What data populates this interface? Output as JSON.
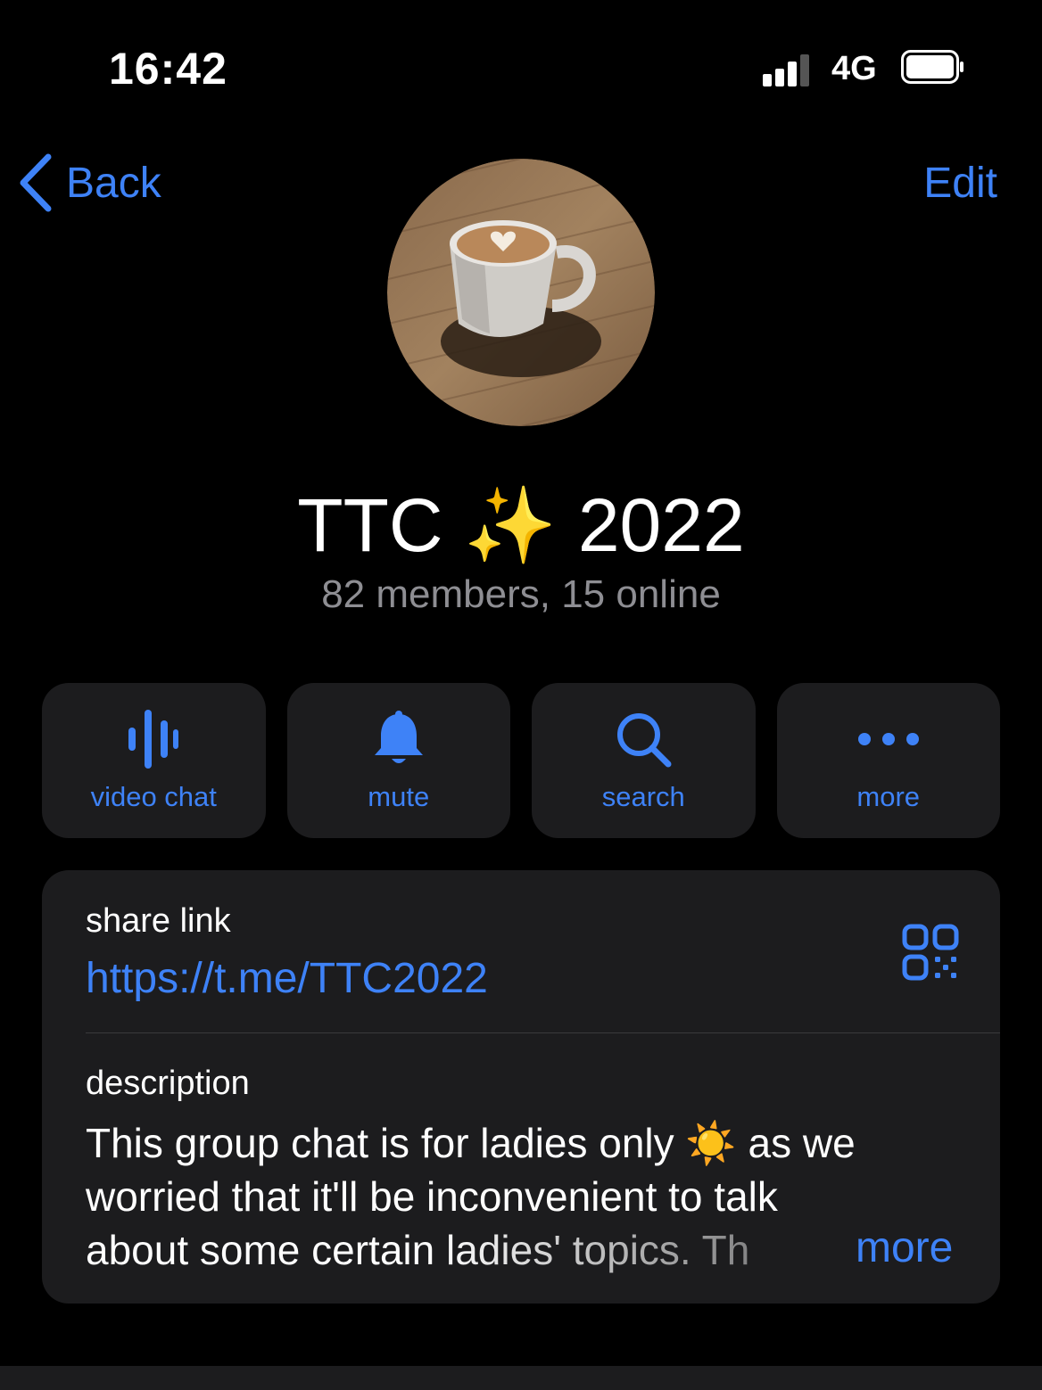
{
  "status_bar": {
    "time": "16:42",
    "network": "4G"
  },
  "nav": {
    "back_label": "Back",
    "edit_label": "Edit"
  },
  "group": {
    "name": "TTC ✨ 2022",
    "members": "82 members, 15 online"
  },
  "actions": [
    {
      "label": "video chat",
      "icon": "video-chat-icon"
    },
    {
      "label": "mute",
      "icon": "bell-icon"
    },
    {
      "label": "search",
      "icon": "search-icon"
    },
    {
      "label": "more",
      "icon": "ellipsis-icon"
    }
  ],
  "info": {
    "share_label": "share link",
    "share_url": "https://t.me/TTC2022",
    "description_label": "description",
    "description_lines": [
      "This group chat is for ladies only ☀️ as we",
      "worried that it'll be inconvenient to talk",
      "about some certain ladies' topics. Th"
    ],
    "more_label": "more"
  },
  "colors": {
    "accent": "#3e82f7",
    "background": "#000000",
    "card": "#1c1c1e",
    "secondary_text": "#8e8e93"
  }
}
